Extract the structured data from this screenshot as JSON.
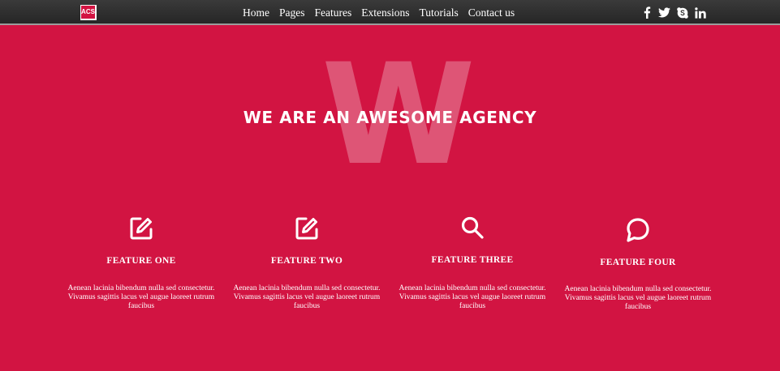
{
  "logo": {
    "text": "ACS"
  },
  "nav": {
    "items": [
      "Home",
      "Pages",
      "Features",
      "Extensions",
      "Tutorials",
      "Contact us"
    ]
  },
  "social": [
    "facebook-icon",
    "twitter-icon",
    "skype-icon",
    "linkedin-icon"
  ],
  "hero": {
    "watermark": "W",
    "title": "WE ARE AN AWESOME AGENCY"
  },
  "features": [
    {
      "icon": "edit-icon",
      "title": "FEATURE ONE",
      "text": "Aenean lacinia bibendum nulla sed consectetur. Vivamus sagittis lacus vel augue laoreet rutrum faucibus"
    },
    {
      "icon": "edit-icon",
      "title": "FEATURE TWO",
      "text": "Aenean lacinia bibendum nulla sed consectetur. Vivamus sagittis lacus vel augue laoreet rutrum faucibus"
    },
    {
      "icon": "search-icon",
      "title": "FEATURE THREE",
      "text": "Aenean lacinia bibendum nulla sed consectetur. Vivamus sagittis lacus vel augue laoreet rutrum faucibus"
    },
    {
      "icon": "chat-bubble-icon",
      "title": "FEATURE FOUR",
      "text": "Aenean lacinia bibendum nulla sed consectetur. Vivamus sagittis lacus vel augue laoreet rutrum faucibus"
    }
  ],
  "colors": {
    "background": "#d21442",
    "navbar": "#2e2e2e",
    "text": "#ffffff"
  }
}
